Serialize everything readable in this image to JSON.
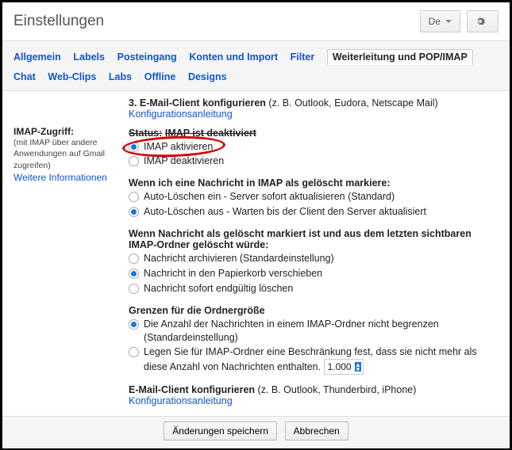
{
  "header": {
    "title": "Einstellungen",
    "lang_label": "De"
  },
  "tabs": {
    "row1": [
      "Allgemein",
      "Labels",
      "Posteingang",
      "Konten und Import",
      "Filter"
    ],
    "active": "Weiterleitung und POP/IMAP",
    "row2": [
      "Chat",
      "Web-Clips",
      "Labs",
      "Offline",
      "Designs"
    ]
  },
  "step3": {
    "title": "3. E-Mail-Client konfigurieren",
    "hint": "(z. B. Outlook, Eudora, Netscape Mail)",
    "link": "Konfigurationsanleitung"
  },
  "left": {
    "title": "IMAP-Zugriff:",
    "sub": "(mit IMAP über andere Anwendungen auf Gmail zugreifen)",
    "link": "Weitere Informationen"
  },
  "status": {
    "label": "Status:",
    "value": "IMAP ist deaktiviert",
    "enable": "IMAP aktivieren",
    "disable": "IMAP deaktivieren"
  },
  "deleted": {
    "title": "Wenn ich eine Nachricht in IMAP als gelöscht markiere:",
    "opt1": "Auto-Löschen ein - Server sofort aktualisieren (Standard)",
    "opt2": "Auto-Löschen aus - Warten bis der Client den Server aktualisiert"
  },
  "lastfolder": {
    "title": "Wenn Nachricht als gelöscht markiert ist und aus dem letzten sichtbaren IMAP-Ordner gelöscht würde:",
    "opt1": "Nachricht archivieren (Standardeinstellung)",
    "opt2": "Nachricht in den Papierkorb verschieben",
    "opt3": "Nachricht sofort endgültig löschen"
  },
  "limits": {
    "title": "Grenzen für die Ordnergröße",
    "opt1": "Die Anzahl der Nachrichten in einem IMAP-Ordner nicht begrenzen (Standardeinstellung)",
    "opt2": "Legen Sie für IMAP-Ordner eine Beschränkung fest, dass sie nicht mehr als diese Anzahl von Nachrichten enthalten.",
    "select_value": "1.000"
  },
  "configure": {
    "title": "E-Mail-Client konfigurieren",
    "hint": "(z. B. Outlook, Thunderbird, iPhone)",
    "link": "Konfigurationsanleitung"
  },
  "footer": {
    "save": "Änderungen speichern",
    "cancel": "Abbrechen"
  }
}
